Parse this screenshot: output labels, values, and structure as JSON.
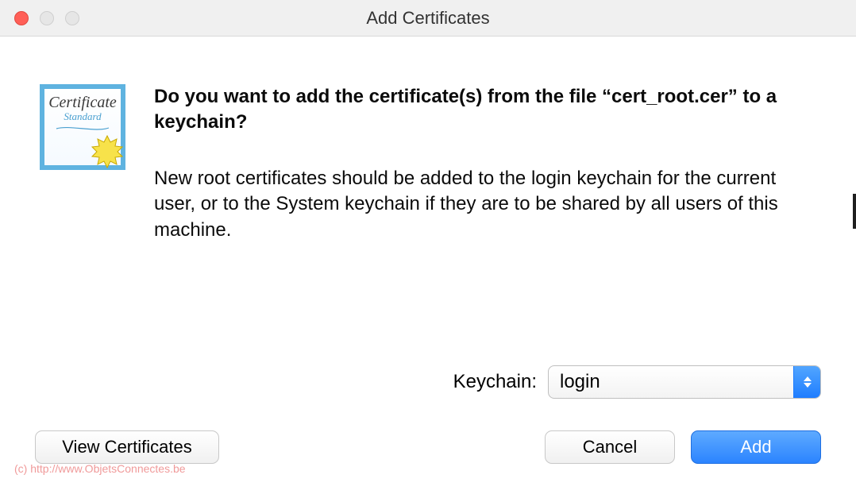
{
  "window": {
    "title": "Add Certificates"
  },
  "icon": {
    "line1": "Certificate",
    "line2": "Standard"
  },
  "dialog": {
    "heading": "Do you want to add the certificate(s) from the file “cert_root.cer” to a keychain?",
    "description": "New root certificates should be added to the login keychain for the current user, or to the System keychain if they are to be shared by all users of this machine."
  },
  "keychain": {
    "label": "Keychain:",
    "value": "login"
  },
  "buttons": {
    "view": "View Certificates",
    "cancel": "Cancel",
    "add": "Add"
  },
  "watermark": "(c) http://www.ObjetsConnectes.be"
}
